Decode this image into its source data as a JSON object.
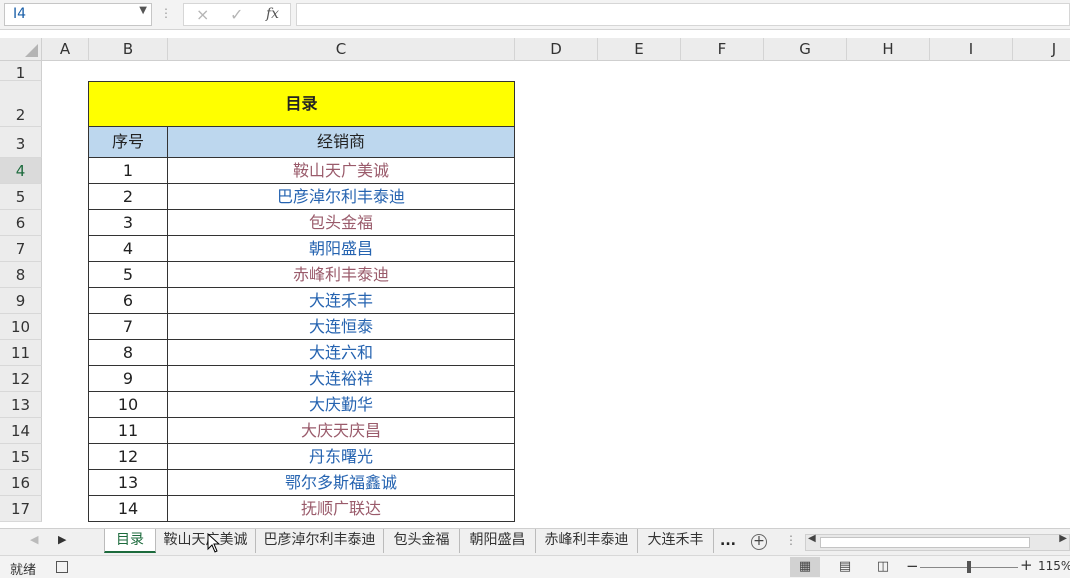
{
  "formula_bar": {
    "name_box": "I4",
    "cancel_icon": "×",
    "enter_icon": "✓",
    "fx_label": "fx",
    "formula": ""
  },
  "columns": [
    "A",
    "B",
    "C",
    "D",
    "E",
    "F",
    "G",
    "H",
    "I",
    "J"
  ],
  "rows": [
    "1",
    "2",
    "3",
    "4",
    "5",
    "6",
    "7",
    "8",
    "9",
    "10",
    "11",
    "12",
    "13",
    "14",
    "15",
    "16",
    "17"
  ],
  "table": {
    "title": "目录",
    "header_index": "序号",
    "header_name": "经销商",
    "entries": [
      {
        "index": "1",
        "name": "鞍山天广美诚",
        "style": "purple"
      },
      {
        "index": "2",
        "name": "巴彦淖尔利丰泰迪",
        "style": "blue"
      },
      {
        "index": "3",
        "name": "包头金福",
        "style": "purple"
      },
      {
        "index": "4",
        "name": "朝阳盛昌",
        "style": "blue"
      },
      {
        "index": "5",
        "name": "赤峰利丰泰迪",
        "style": "purple"
      },
      {
        "index": "6",
        "name": "大连禾丰",
        "style": "blue"
      },
      {
        "index": "7",
        "name": "大连恒泰",
        "style": "blue"
      },
      {
        "index": "8",
        "name": "大连六和",
        "style": "blue"
      },
      {
        "index": "9",
        "name": "大连裕祥",
        "style": "blue"
      },
      {
        "index": "10",
        "name": "大庆勤华",
        "style": "blue"
      },
      {
        "index": "11",
        "name": "大庆天庆昌",
        "style": "purple"
      },
      {
        "index": "12",
        "name": "丹东曙光",
        "style": "blue"
      },
      {
        "index": "13",
        "name": "鄂尔多斯福鑫诚",
        "style": "blue"
      },
      {
        "index": "14",
        "name": "抚顺广联达",
        "style": "purple"
      }
    ]
  },
  "sheet_tabs": [
    "目录",
    "鞍山天广美诚",
    "巴彦淖尔利丰泰迪",
    "包头金福",
    "朝阳盛昌",
    "赤峰利丰泰迪",
    "大连禾丰"
  ],
  "tab_more": "...",
  "status": {
    "ready": "就绪",
    "zoom": "115%"
  },
  "colors": {
    "title_fill": "#ffff00",
    "header_fill": "#bdd7ee",
    "link_visited": "#9a5b6b",
    "link_blue": "#2563b0",
    "accent": "#1d6b3d"
  },
  "icons": {
    "name_box_dropdown": "chevron-down-icon",
    "cancel": "close-icon",
    "enter": "check-icon",
    "function": "fx-icon",
    "add_sheet": "plus-circle-icon",
    "normal_view": "grid-view-icon",
    "page_layout": "page-layout-icon",
    "page_break": "page-break-icon"
  }
}
